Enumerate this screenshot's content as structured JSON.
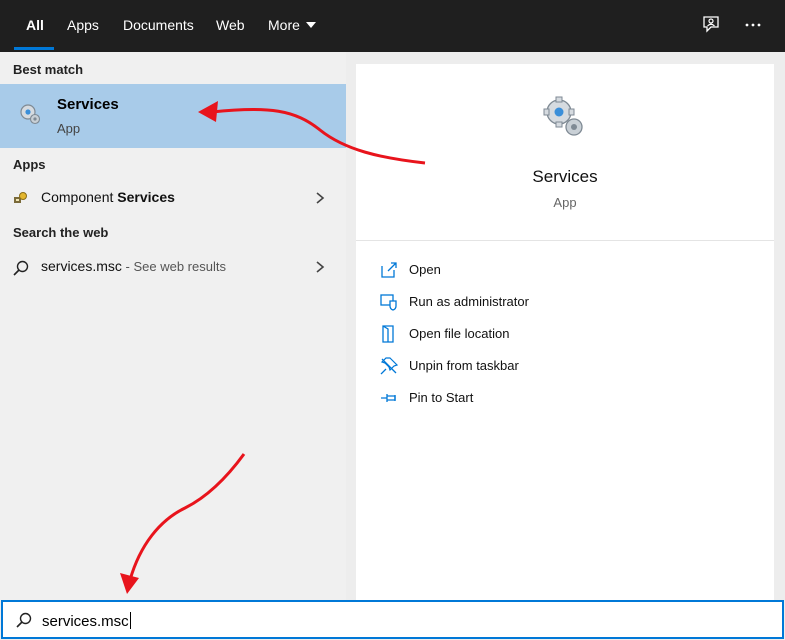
{
  "tabs": [
    {
      "label": "All"
    },
    {
      "label": "Apps"
    },
    {
      "label": "Documents"
    },
    {
      "label": "Web"
    },
    {
      "label": "More"
    }
  ],
  "topbar_icons": [
    "feedback-icon",
    "more-options-icon"
  ],
  "sections": {
    "best_match": "Best match",
    "apps": "Apps",
    "search_web": "Search the web"
  },
  "best_match": {
    "title": "Services",
    "subtitle": "App"
  },
  "apps_list": [
    {
      "prefix": "Component ",
      "bold": "Services"
    }
  ],
  "web_list": [
    {
      "query": "services.msc",
      "suffix": " - See web results"
    }
  ],
  "details": {
    "title": "Services",
    "subtitle": "App",
    "actions": [
      {
        "label": "Open",
        "icon": "open-icon"
      },
      {
        "label": "Run as administrator",
        "icon": "shield-icon"
      },
      {
        "label": "Open file location",
        "icon": "folder-icon"
      },
      {
        "label": "Unpin from taskbar",
        "icon": "unpin-icon"
      },
      {
        "label": "Pin to Start",
        "icon": "pin-icon"
      }
    ]
  },
  "search": {
    "value": "services.msc"
  },
  "colors": {
    "accent": "#0078d7",
    "selected": "#a8cbe9",
    "annotation_arrow": "#e8141c"
  }
}
